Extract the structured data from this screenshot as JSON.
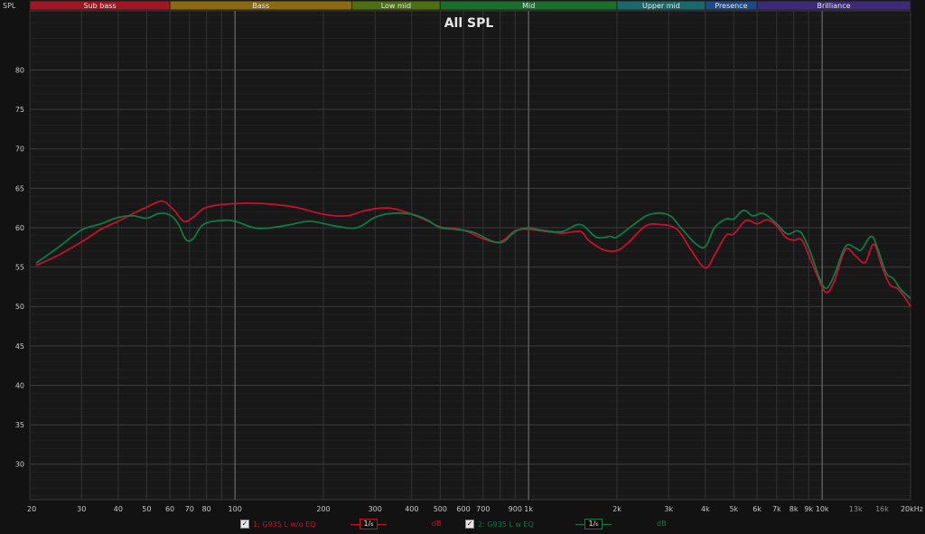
{
  "colors": {
    "background": "#121212",
    "plot_bg": "#181818",
    "series1": "#c8102e",
    "series2": "#0e7a45"
  },
  "bands": [
    {
      "label": "Sub bass",
      "from": 20,
      "to": 60,
      "color": "#a01622"
    },
    {
      "label": "Bass",
      "from": 60,
      "to": 250,
      "color": "#8c6a10"
    },
    {
      "label": "Low mid",
      "from": 250,
      "to": 500,
      "color": "#4d7010"
    },
    {
      "label": "Mid",
      "from": 500,
      "to": 2000,
      "color": "#1b6e2c"
    },
    {
      "label": "Upper mid",
      "from": 2000,
      "to": 4000,
      "color": "#19696a"
    },
    {
      "label": "Presence",
      "from": 4000,
      "to": 6000,
      "color": "#1e4a8a"
    },
    {
      "label": "Brilliance",
      "from": 6000,
      "to": 20000,
      "color": "#3d2a78"
    }
  ],
  "legend": {
    "series1": {
      "label": "1: G935 L w/o EQ",
      "smoothing": "1/₆",
      "unit": "dB"
    },
    "series2": {
      "label": "2: G935 L w EQ",
      "smoothing": "1/₆",
      "unit": "dB"
    }
  },
  "chart_data": {
    "type": "line",
    "title": "All SPL",
    "ylabel": "SPL",
    "xscale": "log",
    "xlim": [
      20,
      20000
    ],
    "ylim": [
      25.5,
      87.5
    ],
    "y_ticks": [
      30,
      35,
      40,
      45,
      50,
      55,
      60,
      65,
      70,
      75,
      80
    ],
    "x_ticks": [
      {
        "v": 20,
        "label": "20"
      },
      {
        "v": 30,
        "label": "30"
      },
      {
        "v": 40,
        "label": "40"
      },
      {
        "v": 50,
        "label": "50"
      },
      {
        "v": 60,
        "label": "60"
      },
      {
        "v": 70,
        "label": "70"
      },
      {
        "v": 80,
        "label": "80"
      },
      {
        "v": 100,
        "label": "100"
      },
      {
        "v": 200,
        "label": "200"
      },
      {
        "v": 300,
        "label": "300"
      },
      {
        "v": 400,
        "label": "400"
      },
      {
        "v": 500,
        "label": "500"
      },
      {
        "v": 600,
        "label": "600"
      },
      {
        "v": 700,
        "label": "700"
      },
      {
        "v": 900,
        "label": "900"
      },
      {
        "v": 1000,
        "label": "1k"
      },
      {
        "v": 2000,
        "label": "2k"
      },
      {
        "v": 3000,
        "label": "3k"
      },
      {
        "v": 4000,
        "label": "4k"
      },
      {
        "v": 5000,
        "label": "5k"
      },
      {
        "v": 6000,
        "label": "6k"
      },
      {
        "v": 7000,
        "label": "7k"
      },
      {
        "v": 8000,
        "label": "8k"
      },
      {
        "v": 9000,
        "label": "9k"
      },
      {
        "v": 10000,
        "label": "10k"
      },
      {
        "v": 13000,
        "label": "13k",
        "dim": true
      },
      {
        "v": 16000,
        "label": "16k",
        "dim": true
      },
      {
        "v": 20000,
        "label": "20kHz"
      }
    ],
    "grid": true,
    "series": [
      {
        "name": "1: G935 L w/o EQ",
        "color": "#c8102e",
        "points": [
          [
            21,
            55.2
          ],
          [
            25,
            56.5
          ],
          [
            30,
            58.2
          ],
          [
            35,
            59.8
          ],
          [
            40,
            60.8
          ],
          [
            45,
            61.8
          ],
          [
            50,
            62.6
          ],
          [
            55,
            63.3
          ],
          [
            58,
            63.2
          ],
          [
            62,
            62.2
          ],
          [
            67,
            60.8
          ],
          [
            72,
            61.3
          ],
          [
            78,
            62.4
          ],
          [
            85,
            62.8
          ],
          [
            95,
            63.0
          ],
          [
            110,
            63.1
          ],
          [
            130,
            63.0
          ],
          [
            160,
            62.6
          ],
          [
            200,
            61.7
          ],
          [
            240,
            61.5
          ],
          [
            280,
            62.2
          ],
          [
            330,
            62.5
          ],
          [
            380,
            62.0
          ],
          [
            450,
            60.9
          ],
          [
            500,
            60.1
          ],
          [
            560,
            59.9
          ],
          [
            620,
            59.5
          ],
          [
            700,
            58.6
          ],
          [
            800,
            58.2
          ],
          [
            900,
            59.6
          ],
          [
            1000,
            59.8
          ],
          [
            1100,
            59.6
          ],
          [
            1300,
            59.3
          ],
          [
            1500,
            59.5
          ],
          [
            1600,
            58.4
          ],
          [
            1800,
            57.2
          ],
          [
            2000,
            57.1
          ],
          [
            2200,
            58.2
          ],
          [
            2500,
            60.2
          ],
          [
            2800,
            60.4
          ],
          [
            3200,
            59.8
          ],
          [
            3600,
            57.0
          ],
          [
            4000,
            54.9
          ],
          [
            4300,
            56.5
          ],
          [
            4700,
            59.0
          ],
          [
            5000,
            59.2
          ],
          [
            5500,
            60.9
          ],
          [
            6000,
            60.5
          ],
          [
            6500,
            61.0
          ],
          [
            7000,
            60.2
          ],
          [
            7500,
            58.8
          ],
          [
            8000,
            58.4
          ],
          [
            8500,
            58.5
          ],
          [
            9000,
            56.5
          ],
          [
            9600,
            54.0
          ],
          [
            10300,
            51.8
          ],
          [
            11000,
            53.2
          ],
          [
            12000,
            57.2
          ],
          [
            13000,
            56.4
          ],
          [
            14000,
            55.6
          ],
          [
            15000,
            57.9
          ],
          [
            16000,
            55.0
          ],
          [
            17000,
            52.8
          ],
          [
            18000,
            52.3
          ],
          [
            19000,
            51.3
          ],
          [
            20000,
            50.0
          ]
        ]
      },
      {
        "name": "2: G935 L w EQ",
        "color": "#0e7a45",
        "points": [
          [
            21,
            55.5
          ],
          [
            25,
            57.5
          ],
          [
            30,
            59.7
          ],
          [
            35,
            60.5
          ],
          [
            40,
            61.3
          ],
          [
            45,
            61.5
          ],
          [
            50,
            61.2
          ],
          [
            55,
            61.8
          ],
          [
            60,
            61.6
          ],
          [
            64,
            60.5
          ],
          [
            68,
            58.5
          ],
          [
            72,
            58.6
          ],
          [
            78,
            60.4
          ],
          [
            90,
            60.9
          ],
          [
            100,
            60.8
          ],
          [
            120,
            59.9
          ],
          [
            150,
            60.3
          ],
          [
            180,
            60.8
          ],
          [
            220,
            60.2
          ],
          [
            260,
            60.0
          ],
          [
            300,
            61.3
          ],
          [
            340,
            61.8
          ],
          [
            400,
            61.7
          ],
          [
            450,
            61.0
          ],
          [
            500,
            60.0
          ],
          [
            560,
            59.8
          ],
          [
            650,
            59.4
          ],
          [
            750,
            58.3
          ],
          [
            820,
            58.2
          ],
          [
            900,
            59.5
          ],
          [
            1000,
            60.0
          ],
          [
            1100,
            59.7
          ],
          [
            1300,
            59.5
          ],
          [
            1500,
            60.4
          ],
          [
            1700,
            58.8
          ],
          [
            1900,
            58.9
          ],
          [
            2000,
            58.8
          ],
          [
            2300,
            60.5
          ],
          [
            2600,
            61.7
          ],
          [
            3000,
            61.6
          ],
          [
            3300,
            60.0
          ],
          [
            3700,
            58.0
          ],
          [
            4000,
            57.6
          ],
          [
            4300,
            60.0
          ],
          [
            4700,
            61.1
          ],
          [
            5000,
            61.1
          ],
          [
            5400,
            62.2
          ],
          [
            5800,
            61.5
          ],
          [
            6300,
            61.8
          ],
          [
            7000,
            60.5
          ],
          [
            7600,
            59.2
          ],
          [
            8200,
            59.6
          ],
          [
            8600,
            59.0
          ],
          [
            9200,
            56.5
          ],
          [
            9700,
            54.0
          ],
          [
            10300,
            52.3
          ],
          [
            11000,
            54.0
          ],
          [
            12000,
            57.6
          ],
          [
            13000,
            57.4
          ],
          [
            13600,
            57.2
          ],
          [
            14700,
            58.9
          ],
          [
            15500,
            57.2
          ],
          [
            16500,
            54.3
          ],
          [
            17500,
            53.5
          ],
          [
            18500,
            52.2
          ],
          [
            20000,
            51.0
          ]
        ]
      }
    ]
  }
}
